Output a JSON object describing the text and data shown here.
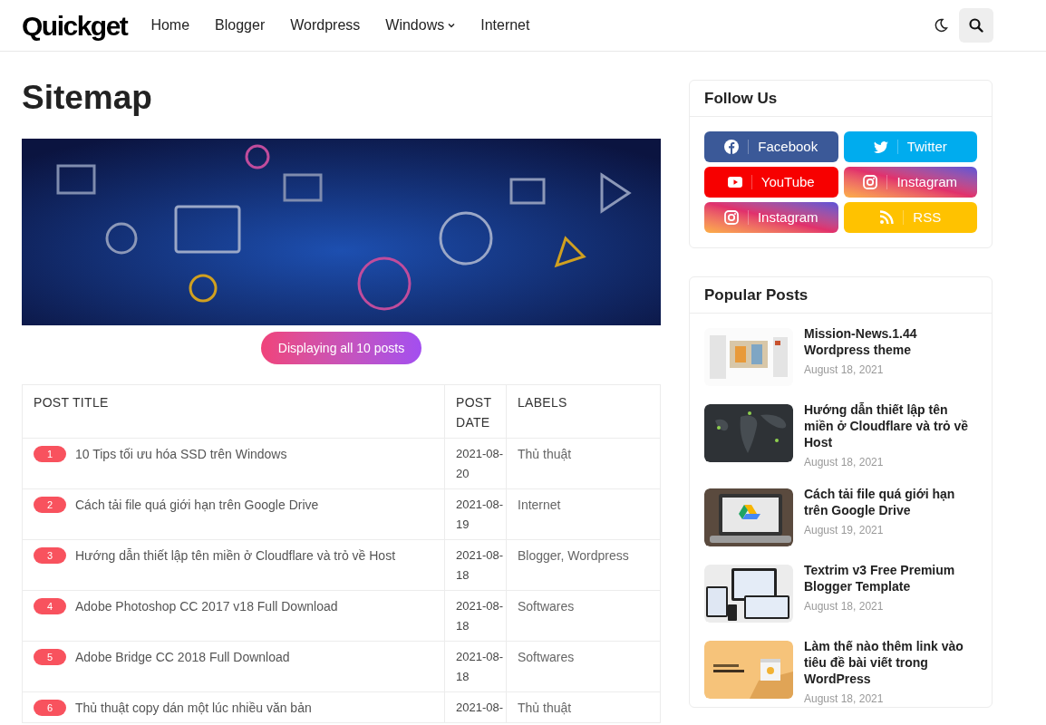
{
  "header": {
    "logo": "Quickget",
    "nav": [
      {
        "label": "Home",
        "dropdown": false
      },
      {
        "label": "Blogger",
        "dropdown": false
      },
      {
        "label": "Wordpress",
        "dropdown": false
      },
      {
        "label": "Windows",
        "dropdown": true
      },
      {
        "label": "Internet",
        "dropdown": false
      }
    ]
  },
  "page": {
    "title": "Sitemap",
    "count_button": "Displaying all 10 posts",
    "table": {
      "columns": [
        "POST TITLE",
        "POST DATE",
        "LABELS"
      ],
      "rows": [
        {
          "number": "1",
          "title": "10 Tips tối ưu hóa SSD trên Windows",
          "date": "2021-08-20",
          "labels": "Thủ thuật"
        },
        {
          "number": "2",
          "title": "Cách tải file quá giới hạn trên Google Drive",
          "date": "2021-08-19",
          "labels": "Internet"
        },
        {
          "number": "3",
          "title": "Hướng dẫn thiết lập tên miền ở Cloudflare và trỏ về Host",
          "date": "2021-08-18",
          "labels": "Blogger, Wordpress"
        },
        {
          "number": "4",
          "title": "Adobe Photoshop CC 2017 v18 Full Download",
          "date": "2021-08-18",
          "labels": "Softwares"
        },
        {
          "number": "5",
          "title": "Adobe Bridge CC 2018 Full Download",
          "date": "2021-08-18",
          "labels": "Softwares"
        },
        {
          "number": "6",
          "title": "Thủ thuật copy dán một lúc nhiều văn bản",
          "date": "2021-08-",
          "labels": "Thủ thuật"
        }
      ]
    }
  },
  "sidebar": {
    "follow": {
      "title": "Follow Us",
      "buttons": [
        {
          "kind": "facebook",
          "label": "Facebook"
        },
        {
          "kind": "twitter",
          "label": "Twitter"
        },
        {
          "kind": "youtube",
          "label": "YouTube"
        },
        {
          "kind": "instagram",
          "label": "Instagram"
        },
        {
          "kind": "instagram",
          "label": "Instagram"
        },
        {
          "kind": "rss",
          "label": "RSS"
        }
      ]
    },
    "popular": {
      "title": "Popular Posts",
      "posts": [
        {
          "title": "Mission-News.1.44 Wordpress theme",
          "date": "August 18, 2021"
        },
        {
          "title": "Hướng dẫn thiết lập tên miền ở Cloudflare và trỏ về Host",
          "date": "August 18, 2021"
        },
        {
          "title": "Cách tải file quá giới hạn trên Google Drive",
          "date": "August 19, 2021"
        },
        {
          "title": "Textrim v3 Free Premium Blogger Template",
          "date": "August 18, 2021"
        },
        {
          "title": "Làm thế nào thêm link vào tiêu đề bài viết trong WordPress",
          "date": "August 18, 2021"
        }
      ]
    }
  }
}
